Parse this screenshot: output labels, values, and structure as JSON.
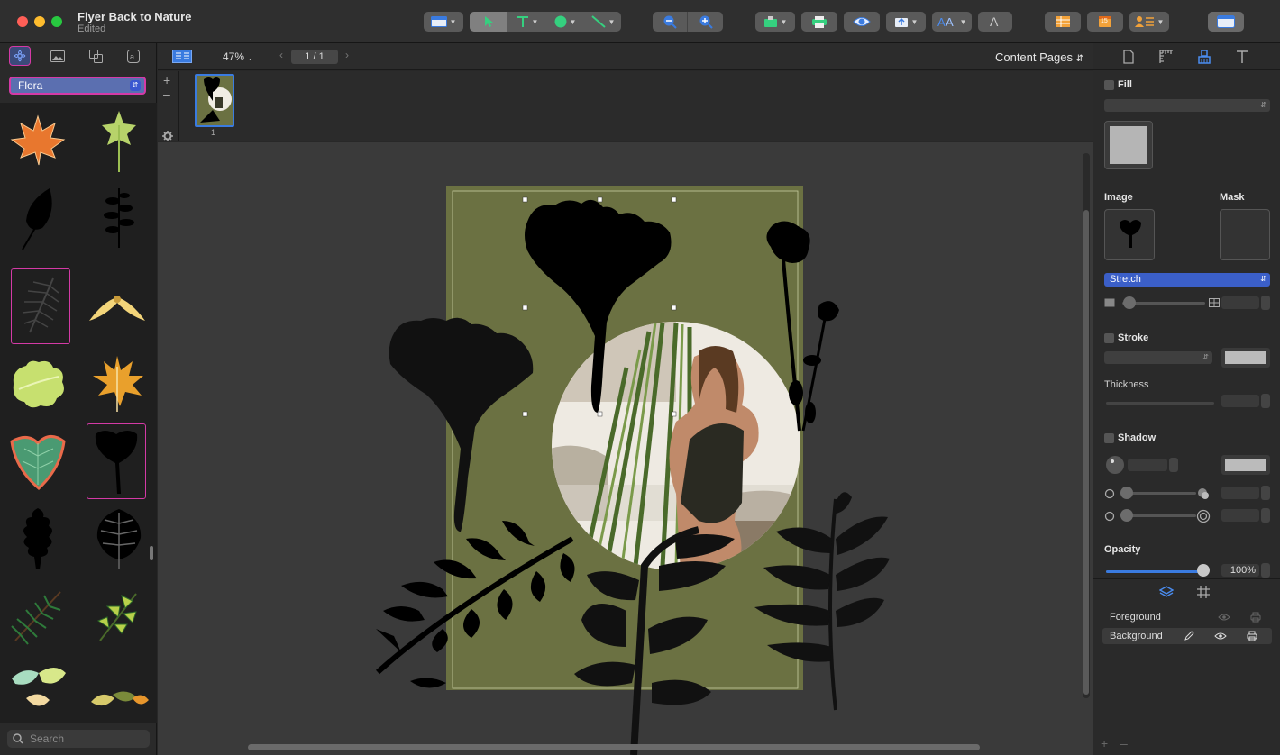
{
  "window": {
    "title": "Flyer Back to Nature",
    "status": "Edited"
  },
  "colors": {
    "accent": "#3b57d0",
    "selection": "#d43aa6",
    "page_fill": "#6b7142",
    "close": "#ff5f57",
    "minimize": "#febc2e",
    "zoom": "#28c840"
  },
  "toolbar": {
    "tools": [
      "layout-icon",
      "select-arrow-icon",
      "text-tool-icon",
      "shape-tool-icon",
      "line-tool-icon",
      "zoom-out-icon",
      "zoom-in-icon",
      "insert-icon",
      "print-icon",
      "preview-eye-icon",
      "export-icon",
      "font-icon",
      "text-style-icon",
      "table-icon",
      "calendar-icon",
      "contact-icon",
      "sidebar-icon"
    ],
    "calendar_badge": "15"
  },
  "left_panel": {
    "tabs": [
      "flower-icon",
      "image-icon",
      "shapes-icon",
      "text-icon"
    ],
    "category": "Flora",
    "search_placeholder": "Search"
  },
  "canvas_bar": {
    "zoom": "47%",
    "page_indicator": "1 / 1",
    "view_mode": "Content Pages"
  },
  "thumbnails": [
    {
      "number": "1"
    }
  ],
  "inspector": {
    "tabs": [
      "page-icon",
      "ruler-icon",
      "style-icon",
      "text-format-icon"
    ],
    "fill_label": "Fill",
    "image_label": "Image",
    "mask_label": "Mask",
    "image_mode": "Stretch",
    "stroke_label": "Stroke",
    "thickness_label": "Thickness",
    "shadow_label": "Shadow",
    "opacity_label": "Opacity",
    "opacity_value": "100%",
    "opacity_fraction": 1.0
  },
  "layers": {
    "items": [
      {
        "name": "Foreground"
      },
      {
        "name": "Background"
      }
    ]
  }
}
